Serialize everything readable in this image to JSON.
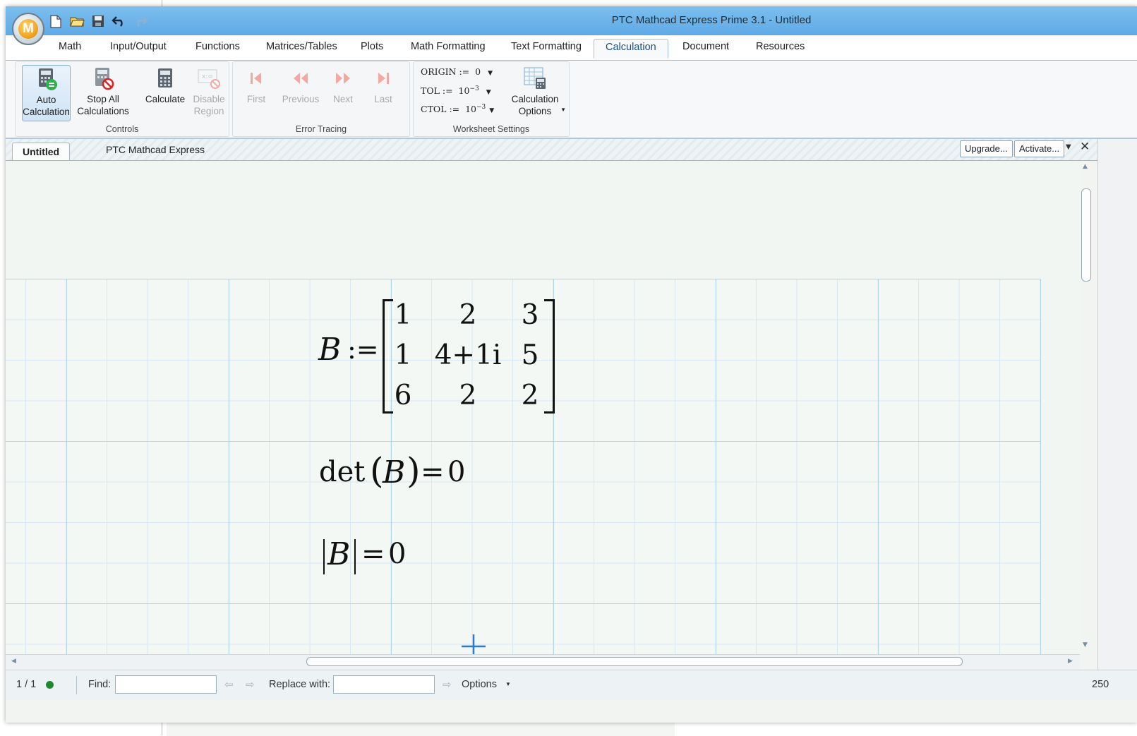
{
  "window": {
    "title": "PTC Mathcad Express Prime 3.1 - Untitled"
  },
  "ribbon_tabs": [
    "Math",
    "Input/Output",
    "Functions",
    "Matrices/Tables",
    "Plots",
    "Math Formatting",
    "Text Formatting",
    "Calculation",
    "Document",
    "Resources"
  ],
  "active_tab": "Calculation",
  "controls_group": {
    "label": "Controls",
    "auto_calc": [
      "Auto",
      "Calculation"
    ],
    "stop_all": [
      "Stop All",
      "Calculations"
    ],
    "calculate": "Calculate",
    "disable_region": [
      "Disable",
      "Region"
    ]
  },
  "error_tracing_group": {
    "label": "Error Tracing",
    "first": "First",
    "previous": "Previous",
    "next": "Next",
    "last": "Last"
  },
  "worksheet_settings_group": {
    "label": "Worksheet Settings",
    "origin": {
      "name": "ORIGIN",
      "assign": ":=",
      "value": "0"
    },
    "tol": {
      "name": "TOL",
      "assign": ":=",
      "base": "10",
      "exp": "−3"
    },
    "ctol": {
      "name": "CTOL",
      "assign": ":=",
      "base": "10",
      "exp": "−3"
    },
    "calc_options": [
      "Calculation",
      "Options"
    ]
  },
  "document_tabs": {
    "active": "Untitled",
    "other": "PTC Mathcad Express"
  },
  "actions": {
    "upgrade": "Upgrade...",
    "activate": "Activate..."
  },
  "worksheet": {
    "matrix_name": "B",
    "assign_op": ":=",
    "matrix": [
      [
        "1",
        "2",
        "3"
      ],
      [
        "1",
        "4+1i",
        "5"
      ],
      [
        "6",
        "2",
        "2"
      ]
    ],
    "det_fn": "det",
    "det_arg": "B",
    "det_result": "0",
    "abs_arg": "B",
    "abs_result": "0",
    "equals": "="
  },
  "status": {
    "page": "1 / 1",
    "find_label": "Find:",
    "replace_label": "Replace with:",
    "options": "Options",
    "zoom_partial": "250"
  }
}
